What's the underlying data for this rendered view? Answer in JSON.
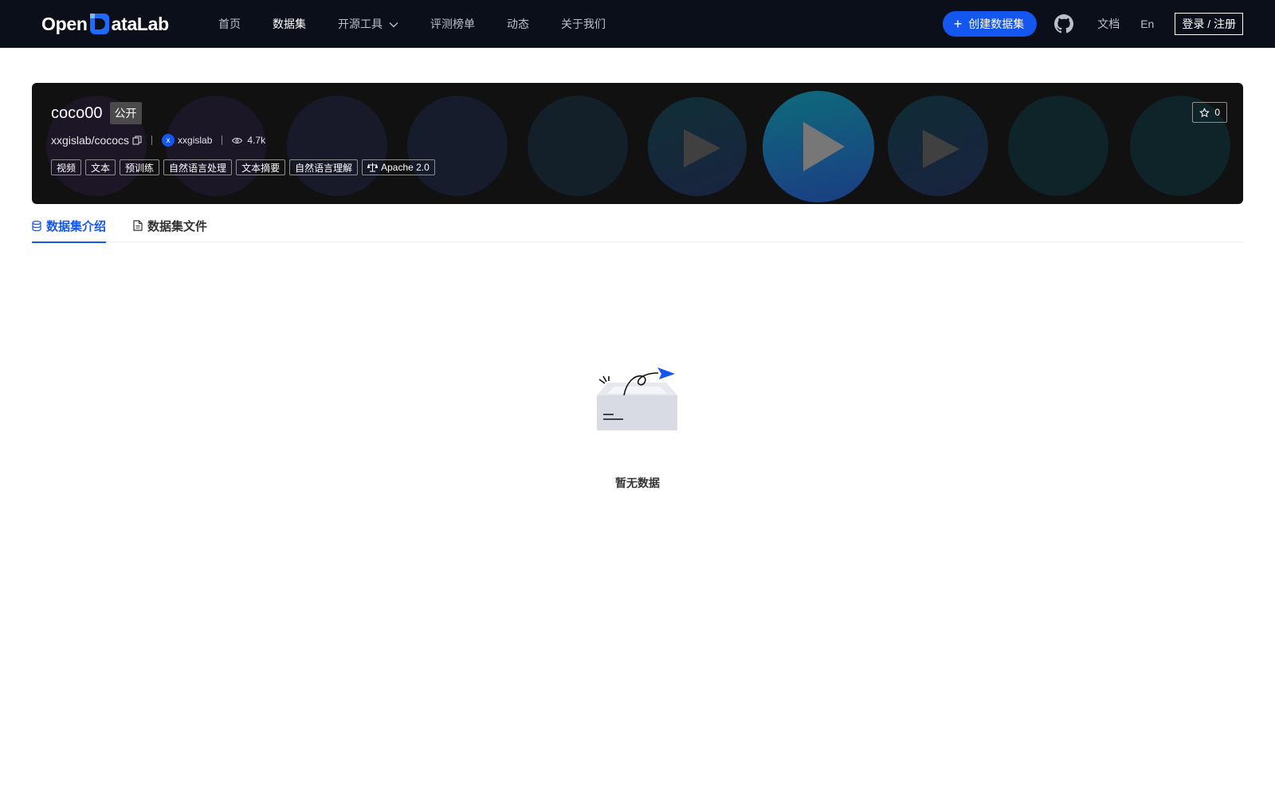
{
  "nav": {
    "logo_text_left": "Open",
    "logo_text_right": "ataLab",
    "links": [
      {
        "label": "首页"
      },
      {
        "label": "数据集"
      },
      {
        "label": "开源工具"
      },
      {
        "label": "评测榜单"
      },
      {
        "label": "动态"
      },
      {
        "label": "关于我们"
      }
    ],
    "create_label": "创建数据集",
    "docs_label": "文档",
    "lang_label": "En",
    "login_label": "登录 / 注册"
  },
  "dataset": {
    "name": "coco00",
    "visibility": "公开",
    "path": "xxgislab/cococs",
    "owner_initial": "x",
    "owner": "xxgislab",
    "views": "4.7k",
    "stars": "0",
    "tags": [
      "视频",
      "文本",
      "预训练",
      "自然语言处理",
      "文本摘要",
      "自然语言理解"
    ],
    "license": "Apache 2.0"
  },
  "tabs": [
    {
      "label": "数据集介绍"
    },
    {
      "label": "数据集文件"
    }
  ],
  "empty": {
    "text": "暂无数据"
  },
  "colors": {
    "accent": "#1456f0",
    "nav_bg": "#0b0f19",
    "banner_bg": "#111111"
  }
}
